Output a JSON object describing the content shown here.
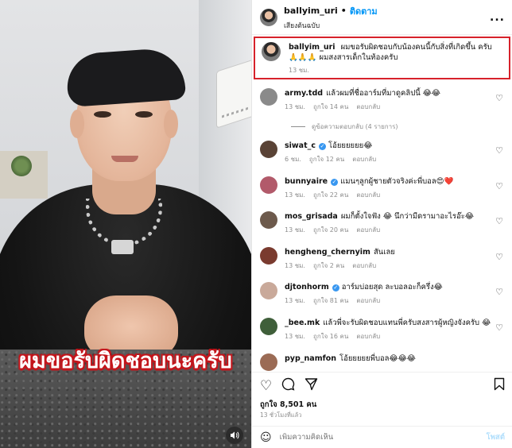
{
  "video": {
    "overlay_text": "ผมขอรับผิดชอบนะครับ",
    "sound_icon": "speaker-icon"
  },
  "post_header": {
    "username": "ballyim_uri",
    "separator": "•",
    "follow_label": "ติดตาม",
    "audio": "เสียงต้นฉบับ",
    "more": "..."
  },
  "caption": {
    "username": "ballyim_uri",
    "text": "ผมขอรับผิดชอบกับน้องคนนี้กับสิ่งที่เกิดขึ้น ครับ 🙏🙏🙏 ผมสงสารเด็กในท้องครับ",
    "time": "13 ชม."
  },
  "comments": [
    {
      "username": "army.tdd",
      "verified": false,
      "text": "แล้วผมที่ชื่ออาร์มที่มาดูคลิปนี้ 😂😂",
      "time": "13 ชม.",
      "likes": "ถูกใจ 14 คน",
      "reply": "ตอบกลับ",
      "avatar_color": "#8a8a8a"
    },
    {
      "username": "siwat_c",
      "verified": true,
      "text": "โอ้ยยยยยย😂",
      "time": "6 ชม.",
      "likes": "ถูกใจ 12 คน",
      "reply": "ตอบกลับ",
      "avatar_color": "#5a4336"
    },
    {
      "username": "bunnyaire",
      "verified": true,
      "text": "แมนๆลูกผู้ชายตัวจริงค่ะพี่บอล😍❤️",
      "time": "13 ชม.",
      "likes": "ถูกใจ 22 คน",
      "reply": "ตอบกลับ",
      "avatar_color": "#b25a6a"
    },
    {
      "username": "mos_grisada",
      "verified": false,
      "text": "ผมก็ตั้งใจฟัง 😂 นึกว่ามีดรามาอะไรอ๊ะ😂",
      "time": "13 ชม.",
      "likes": "ถูกใจ 20 คน",
      "reply": "ตอบกลับ",
      "avatar_color": "#6d5a4c"
    },
    {
      "username": "hengheng_chernyim",
      "verified": false,
      "text": "สันเลย",
      "time": "13 ชม.",
      "likes": "ถูกใจ 2 คน",
      "reply": "ตอบกลับ",
      "avatar_color": "#7a3b2f"
    },
    {
      "username": "djtonhorm",
      "verified": true,
      "text": "อาร์มบ่อยสุด ละบอลอะก็ครึ่ง😂",
      "time": "13 ชม.",
      "likes": "ถูกใจ 81 คน",
      "reply": "ตอบกลับ",
      "avatar_color": "#c9a99a"
    },
    {
      "username": "_bee.mk",
      "verified": false,
      "text": "แล้วพี่จะรับผิดชอบแทนพี่ครับสงสารผู้หญิงจังครับ 😂",
      "time": "13 ชม.",
      "likes": "ถูกใจ 16 คน",
      "reply": "ตอบกลับ",
      "avatar_color": "#3f5f3a"
    },
    {
      "username": "pyp_namfon",
      "verified": false,
      "text": "โอ้ยยยยยพี่บอล😂😂😂",
      "time": "",
      "likes": "",
      "reply": "",
      "avatar_color": "#9b6b55"
    }
  ],
  "view_replies": "ดูข้อความตอบกลับ (4 รายการ)",
  "actions": {
    "like_icon": "heart-icon",
    "comment_icon": "comment-icon",
    "share_icon": "send-icon",
    "save_icon": "bookmark-icon"
  },
  "likes_text": "ถูกใจ 8,501 คน",
  "posted_ago": "13 ชั่วโมงที่แล้ว",
  "composer": {
    "placeholder": "เพิ่มความคิดเห็น",
    "post_label": "โพสต์"
  }
}
